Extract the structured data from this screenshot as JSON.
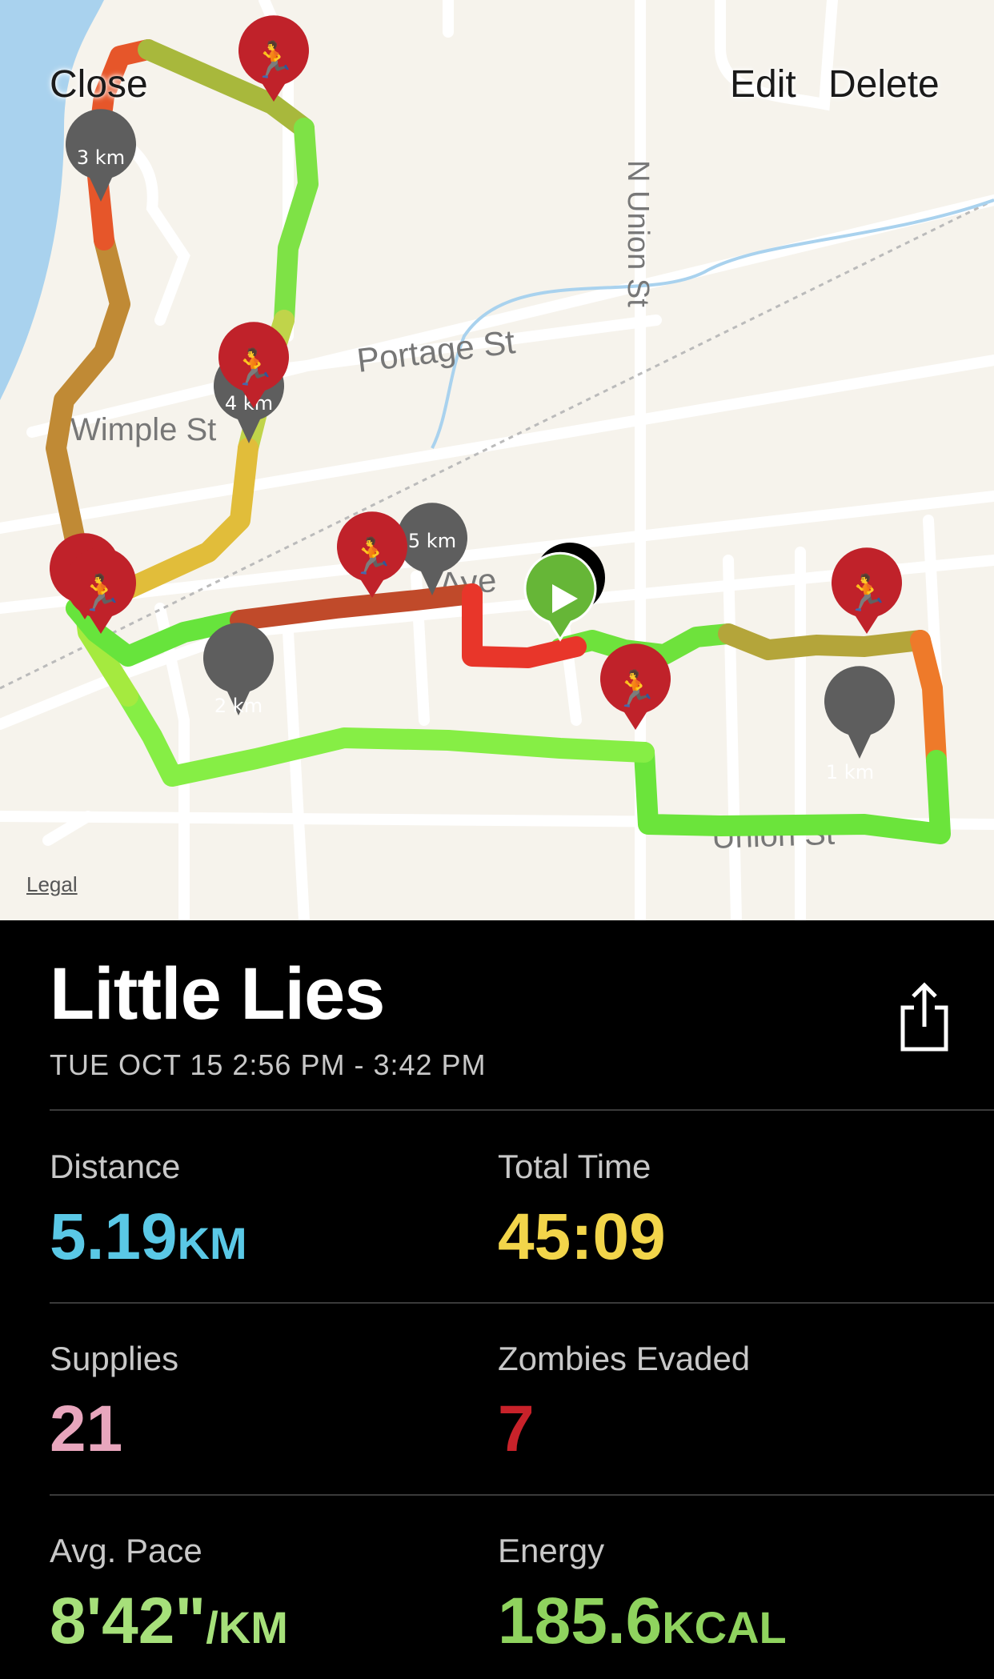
{
  "map": {
    "close_label": "Close",
    "edit_label": "Edit",
    "delete_label": "Delete",
    "legal_label": "Legal",
    "streets": {
      "n_union": "N Union St",
      "portage": "Portage St",
      "wimple": "Wimple St",
      "ave": "Ave",
      "union": "Union St"
    },
    "km_markers": [
      "1 km",
      "2 km",
      "3 km",
      "4 km",
      "5 km"
    ],
    "colors": {
      "water": "#a9d2ee",
      "land": "#f6f3ec",
      "road": "#ffffff",
      "pin_red": "#c0222a",
      "pin_gray": "#5e5e5e",
      "start_green": "#66b637"
    }
  },
  "run": {
    "title": "Little Lies",
    "date_range": "TUE OCT 15 2:56 PM - 3:42 PM"
  },
  "stats": {
    "distance": {
      "label": "Distance",
      "value": "5.19",
      "unit": "KM",
      "color": "#5ac8e6"
    },
    "total_time": {
      "label": "Total Time",
      "value": "45:09",
      "color": "#f2d54a"
    },
    "supplies": {
      "label": "Supplies",
      "value": "21",
      "color": "#e8a6bd"
    },
    "zombies_evaded": {
      "label": "Zombies Evaded",
      "value": "7",
      "color": "#c8222a"
    },
    "avg_pace": {
      "label": "Avg. Pace",
      "value": "8'42\"",
      "unit": "/KM",
      "color": "#a6e07a"
    },
    "energy": {
      "label": "Energy",
      "value": "185.6",
      "unit": "KCAL",
      "color": "#8fd35e"
    }
  },
  "icons": {
    "share": "share-icon",
    "runner_pin": "zombie-runner-pin-icon",
    "start": "play-start-icon",
    "finish": "finish-flag-icon"
  }
}
